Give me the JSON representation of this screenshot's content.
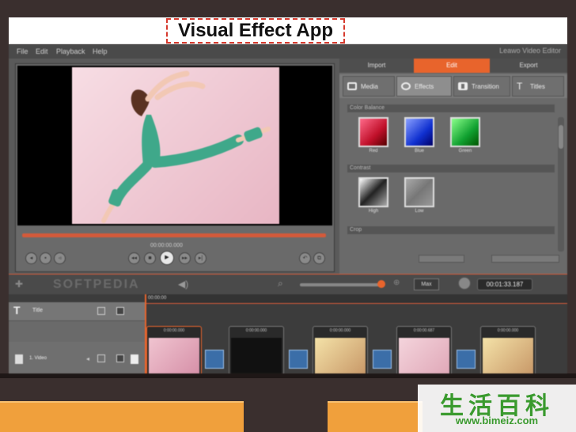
{
  "caption": {
    "title": "Visual Effect App"
  },
  "menubar": {
    "items": [
      "File",
      "Edit",
      "Playback",
      "Help"
    ],
    "brand": "Leawo Video Editor"
  },
  "preview": {
    "timecode": "00:00:00.000"
  },
  "right_panel": {
    "main_tabs": [
      "Import",
      "Edit",
      "Export"
    ],
    "active_main_tab": "Edit",
    "sub_tabs": [
      "Media",
      "Effects",
      "Transition",
      "Titles"
    ],
    "active_sub_tab": "Effects",
    "sections": {
      "color_balance": "Color Balance",
      "contrast": "Contrast",
      "crop": "Crop"
    },
    "effects": {
      "red": "Red",
      "blue": "Blue",
      "green": "Green",
      "high": "High",
      "low": "Low"
    }
  },
  "toolbar": {
    "watermark": "SOFTPEDIA",
    "max_label": "Max",
    "time_display": "00:01:33.187"
  },
  "timeline": {
    "ruler_time": "00:00:00",
    "tracks": {
      "title": "Title",
      "video": "1. Video"
    },
    "clips": [
      "0:00:00.000",
      "0:00:00.000",
      "0:00:00.000",
      "0:00:00.687",
      "0:00:00.000"
    ]
  },
  "watermark": {
    "chinese": "生活百科",
    "url": "www.bimeiz.com"
  },
  "colors": {
    "accent": "#e8642c",
    "caption_border": "#d63a2e",
    "bottom_bar": "#f0a03c",
    "watermark_green": "#3a9a2e"
  }
}
